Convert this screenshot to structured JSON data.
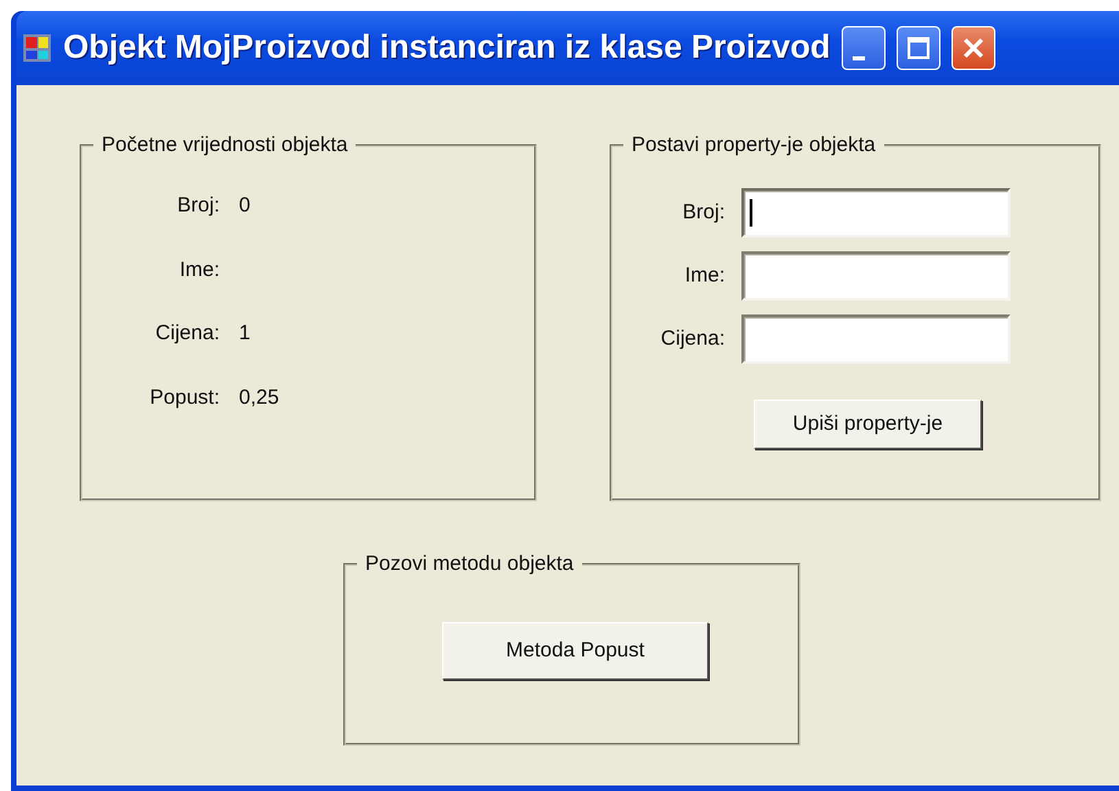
{
  "window": {
    "title": "Objekt MojProizvod instanciran iz klase Proizvod"
  },
  "initial_values": {
    "title": "Početne vrijednosti objekta",
    "rows": [
      {
        "label": "Broj:",
        "value": "0"
      },
      {
        "label": "Ime:",
        "value": ""
      },
      {
        "label": "Cijena:",
        "value": "1"
      },
      {
        "label": "Popust:",
        "value": "0,25"
      }
    ]
  },
  "set_properties": {
    "title": "Postavi property-je objekta",
    "fields": [
      {
        "label": "Broj:",
        "focused": true
      },
      {
        "label": "Ime:",
        "focused": false
      },
      {
        "label": "Cijena:",
        "focused": false
      }
    ],
    "button": "Upiši property-je"
  },
  "call_method": {
    "title": "Pozovi metodu objekta",
    "button": "Metoda Popust"
  }
}
